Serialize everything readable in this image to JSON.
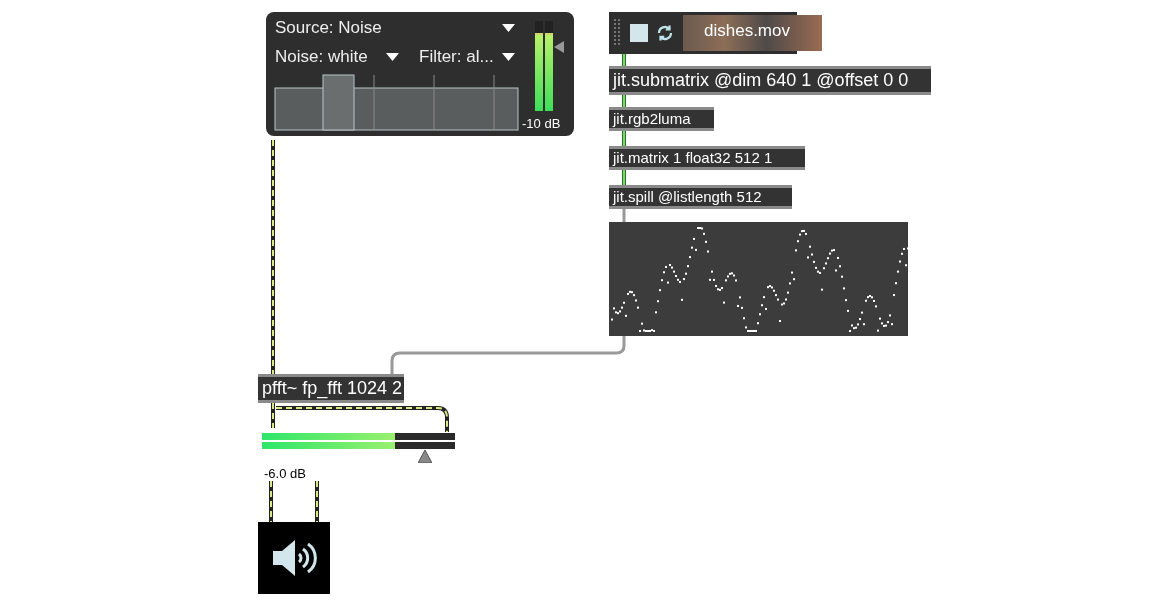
{
  "noise_panel": {
    "source": "Source: Noise",
    "noise": "Noise: white",
    "filter": "Filter: al...",
    "meter": {
      "level": 0.85,
      "reading": "-10 dB"
    }
  },
  "movie_player": {
    "filename": "dishes.mov"
  },
  "objects": [
    {
      "text": "jit.submatrix @dim 640 1 @offset 0 0",
      "kind": "large"
    },
    {
      "text": "jit.rgb2luma",
      "kind": "small"
    },
    {
      "text": "jit.matrix 1 float32 512 1",
      "kind": "small"
    },
    {
      "text": "jit.spill @listlength 512",
      "kind": "small"
    },
    {
      "text": "pfft~ fp_fft 1024 2",
      "kind": "large"
    }
  ],
  "gain_slider": {
    "level": 0.69,
    "reading": "-6.0 dB"
  }
}
